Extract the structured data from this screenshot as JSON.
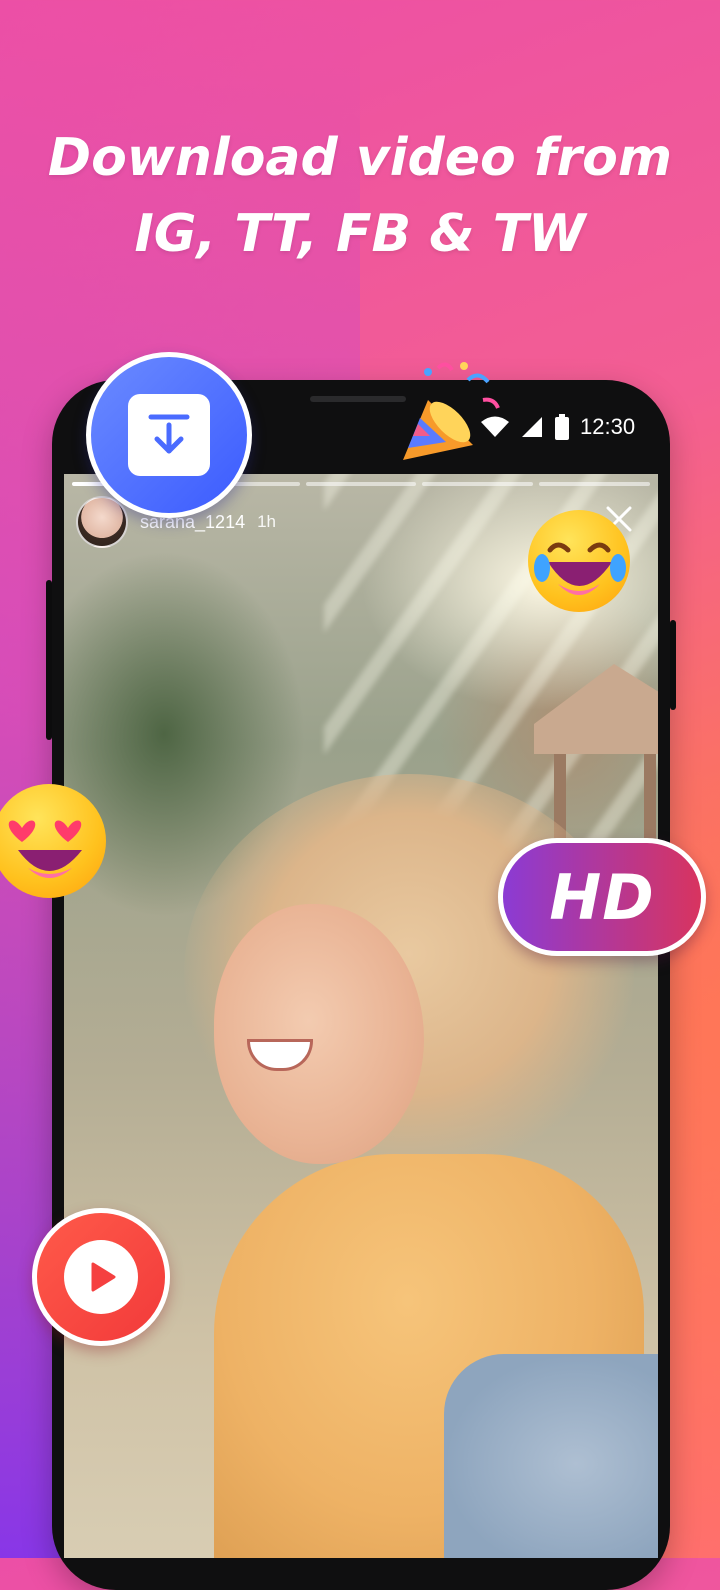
{
  "headline": {
    "line1": "Download video from",
    "line2": "IG, TT, FB & TW"
  },
  "status_bar": {
    "time": "12:30",
    "icons": [
      "wifi-icon",
      "signal-icon",
      "battery-icon"
    ]
  },
  "story": {
    "username": "sarana_1214",
    "age": "1h",
    "progress_segments": 5,
    "active_segment": 1
  },
  "badges": {
    "hd_label": "HD",
    "download_icon": "download-icon",
    "play_icon": "play-icon"
  },
  "colors": {
    "background_top": "#ec4fa6",
    "background_right": "#ff8f2e",
    "background_bottom_left": "#8232f0",
    "download_badge": "#4a6bff",
    "play_badge": "#f54040",
    "hd_gradient_start": "#8b3bd4",
    "hd_gradient_end": "#d8345f"
  }
}
